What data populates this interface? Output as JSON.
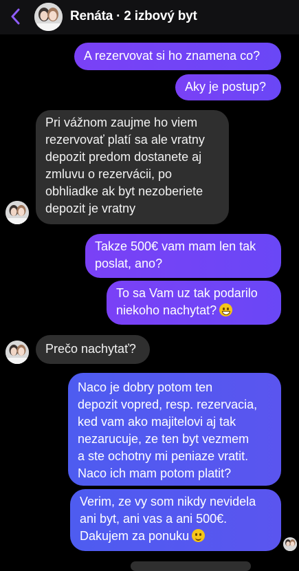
{
  "header": {
    "contact_name": "Renáta",
    "separator": "·",
    "listing": "2 izbový byt",
    "back_icon": "chevron-left-icon",
    "accent_color": "#8e5cf7"
  },
  "messages": [
    {
      "direction": "out",
      "text": "A rezervovat si ho znamena co?"
    },
    {
      "direction": "out",
      "text": "Aky je postup?"
    },
    {
      "direction": "in",
      "lines": [
        "Pri vážnom zaujme ho viem",
        "rezervovať platí sa ale vratny",
        "depozit predom dostanete aj",
        "zmluvu o rezervácii, po",
        "obhliadke ak byt nezoberiete",
        "depozit je vratny"
      ]
    },
    {
      "direction": "out",
      "lines": [
        "Takze 500€ vam mam len tak",
        "poslat, ano?"
      ]
    },
    {
      "direction": "out",
      "lines": [
        "To sa Vam uz tak podarilo",
        "niekoho nachytat?"
      ],
      "emoji": "grinning-face-emoji"
    },
    {
      "direction": "in",
      "text": "Prečo nachytať?"
    },
    {
      "direction": "out",
      "lines": [
        "Naco je dobry potom ten",
        "depozit vopred, resp. rezervacia,",
        "ked vam ako majitelovi aj tak",
        "nezarucuje, ze ten byt vezmem",
        "a ste ochotny mi peniaze vratit.",
        "Naco ich mam potom platit?"
      ]
    },
    {
      "direction": "out",
      "lines": [
        "Verim, ze vy som nikdy nevidela",
        "ani byt, ani vas a ani 500€.",
        "Dakujem za ponuku"
      ],
      "emoji": "slightly-smiling-face-emoji"
    }
  ]
}
